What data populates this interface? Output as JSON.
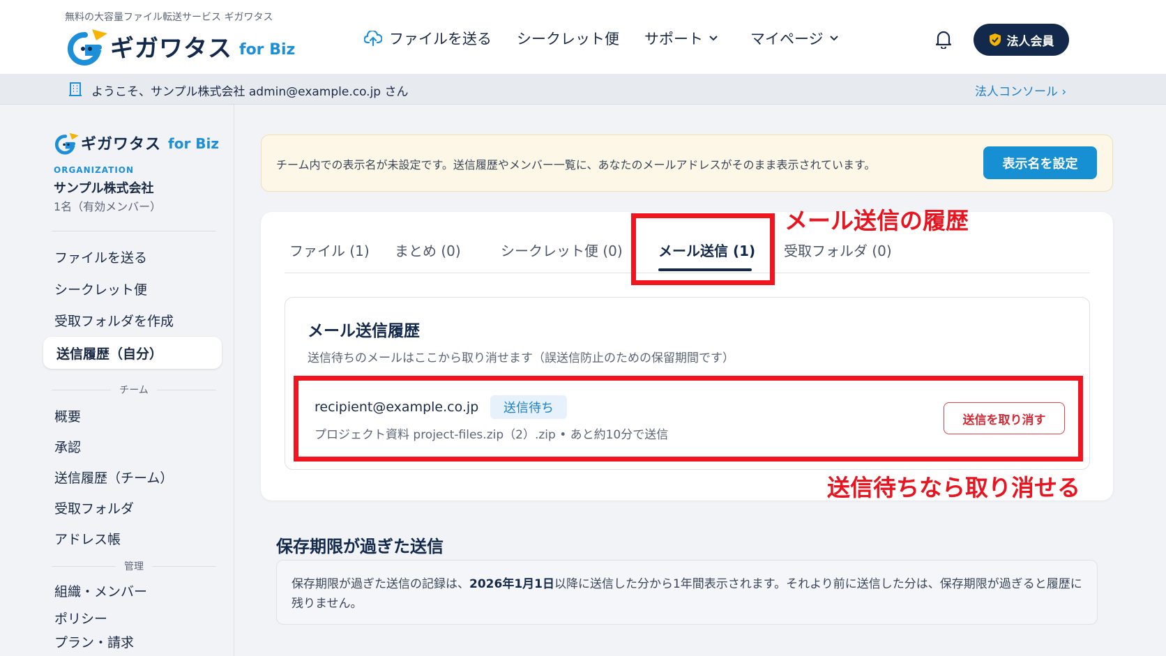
{
  "header": {
    "tagline": "無料の大容量ファイル転送サービス ギガワタス",
    "logo_text": "ギガワタス",
    "logo_biz": "for Biz",
    "nav": [
      {
        "label": "ファイルを送る",
        "icon": "cloud-upload-icon"
      },
      {
        "label": "シークレット便"
      },
      {
        "label": "サポート",
        "icon": "chevron-down-icon"
      },
      {
        "label": "マイページ",
        "icon": "chevron-down-icon"
      }
    ],
    "member_button": "法人会員"
  },
  "welcome": {
    "text": "ようこそ、サンプル株式会社  admin@example.co.jp さん",
    "console_link": "法人コンソール ›"
  },
  "sidebar": {
    "logo_text": "ギガワタス",
    "logo_biz": "for Biz",
    "org_label": "ORGANIZATION",
    "org_name": "サンプル株式会社",
    "org_members": "1名（有効メンバー）",
    "items": [
      "ファイルを送る",
      "シークレット便",
      "受取フォルダを作成",
      "送信履歴（自分）"
    ],
    "team_section": "チーム",
    "team_items": [
      "概要",
      "承認",
      "送信履歴（チーム）",
      "受取フォルダ",
      "アドレス帳"
    ],
    "admin_section": "管理",
    "admin_items": [
      "組織・メンバー",
      "ポリシー",
      "プラン・請求"
    ]
  },
  "notice": {
    "text": "チーム内での表示名が未設定です。送信履歴やメンバー一覧に、あなたのメールアドレスがそのまま表示されています。",
    "button": "表示名を設定"
  },
  "tabs": [
    {
      "label": "ファイル (1)"
    },
    {
      "label": "まとめ (0)"
    },
    {
      "label": "シークレット便 (0)"
    },
    {
      "label": "メール送信 (1)",
      "active": true
    },
    {
      "label": "受取フォルダ (0)"
    }
  ],
  "mail_history": {
    "title": "メール送信履歴",
    "subtitle": "送信待ちのメールはここから取り消せます（誤送信防止のための保留期間です）",
    "row": {
      "email": "recipient@example.co.jp",
      "status": "送信待ち",
      "meta": "プロジェクト資料 project-files.zip（2）.zip  •  あと約10分で送信",
      "cancel": "送信を取り消す"
    }
  },
  "expired": {
    "title": "保存期限が過ぎた送信",
    "text_before": "保存期限が過ぎた送信の記録は、",
    "text_bold": "2026年1月1日",
    "text_after": "以降に送信した分から1年間表示されます。それより前に送信した分は、保存期限が過ぎると履歴に残りません。"
  },
  "annotations": {
    "tab_label": "メール送信の履歴",
    "row_label": "送信待ちなら取り消せる"
  },
  "colors": {
    "navy": "#13294b",
    "accent_blue": "#1690d2",
    "annotation_red": "#f0151e"
  }
}
